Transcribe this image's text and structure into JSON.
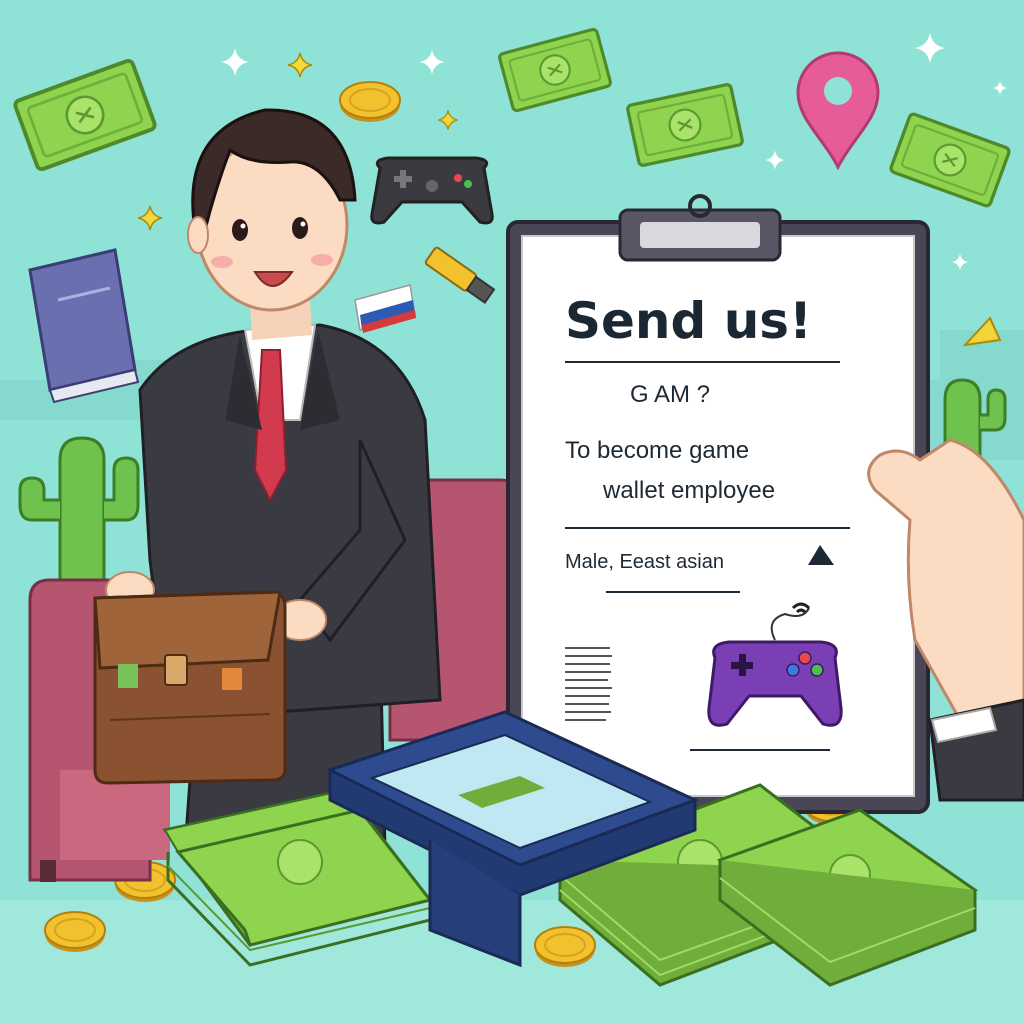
{
  "clipboard": {
    "title": "Send us!",
    "question": "G AM ?",
    "line1": "To become  game",
    "line2": "wallet employee",
    "detail": "Male,  Eeast asian"
  },
  "colors": {
    "background": "#8fe3d6",
    "money": "#8ed44e",
    "coin": "#f2c12e",
    "suit": "#3a3a42",
    "tie": "#d23a4e",
    "sofa": "#b5556f",
    "wallet": "#8a5230",
    "controller": "#7b3fb5",
    "pin": "#e65c98",
    "tablet": "#2f4b8f"
  },
  "icons": [
    "banknote-icon",
    "coin-icon",
    "sparkle-icon",
    "location-pin-icon",
    "gamepad-icon",
    "book-icon",
    "flag-icon",
    "cactus-icon",
    "wallet-icon",
    "tablet-icon"
  ]
}
